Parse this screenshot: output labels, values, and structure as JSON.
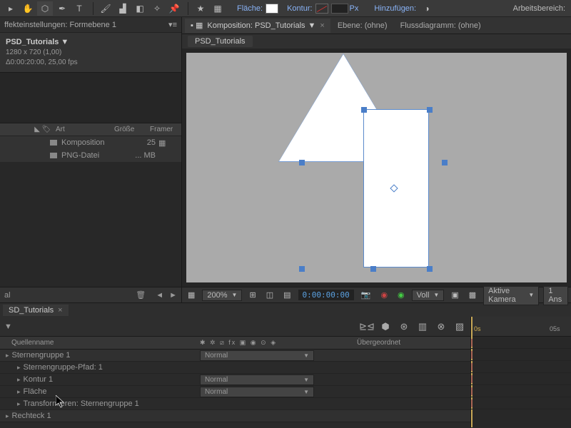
{
  "toolbar": {
    "fill_label": "Fläche:",
    "stroke_label": "Kontur:",
    "px": "Px",
    "add_label": "Hinzufügen:",
    "workspace_label": "Arbeitsbereich:"
  },
  "effects_panel": {
    "title": "ffekteinstellungen: Formebene 1"
  },
  "project": {
    "comp_name": "PSD_Tutorials ▼",
    "dims": "1280 x 720 (1,00)",
    "dur": "Δ0:00:20:00, 25,00 fps",
    "cols": {
      "art": "Art",
      "groesse": "Größe",
      "frames": "Framer"
    },
    "rows": [
      {
        "type": "Komposition",
        "size": "25"
      },
      {
        "type": "PNG-Datei",
        "size": "... MB"
      }
    ]
  },
  "comp_tabs": {
    "komposition": "Komposition: PSD_Tutorials",
    "ebene": "Ebene: (ohne)",
    "fluss": "Flussdiagramm: (ohne)",
    "pill": "PSD_Tutorials"
  },
  "vp_footer": {
    "zoom": "200%",
    "tc": "0:00:00:00",
    "full": "Voll",
    "camera": "Aktive Kamera",
    "ans": "1 Ans"
  },
  "left_footer": {
    "al": "al"
  },
  "timeline": {
    "tab": "SD_Tutorials",
    "cols": {
      "quelle": "Quellenname",
      "ueber": "Übergeordnet"
    },
    "mode": "Normal",
    "time_0s": "0s",
    "time_05s": "05s",
    "layers": [
      {
        "name": "Sternengruppe 1",
        "hasMode": true,
        "indent": 0
      },
      {
        "name": "Sternengruppe-Pfad: 1",
        "hasMode": false,
        "indent": 1
      },
      {
        "name": "Kontur 1",
        "hasMode": true,
        "indent": 1
      },
      {
        "name": "Fläche",
        "hasMode": true,
        "indent": 1
      },
      {
        "name": "Transformieren: Sternengruppe 1",
        "hasMode": false,
        "indent": 1
      },
      {
        "name": "Rechteck 1",
        "hasMode": false,
        "indent": 0
      }
    ]
  }
}
